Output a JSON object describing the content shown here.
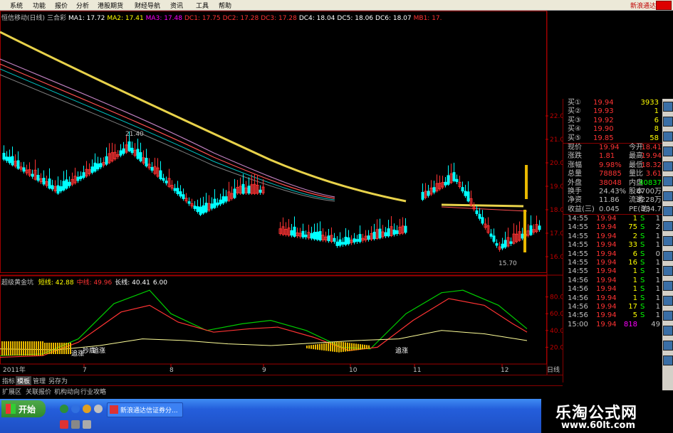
{
  "menu": {
    "items": [
      "系统",
      "功能",
      "报价",
      "分析",
      "港股期货",
      "财经导航",
      "资讯",
      "工具",
      "帮助"
    ],
    "brand": "新浪通达"
  },
  "chart_title": [
    {
      "text": "恒信移动(日线)",
      "color": "#c0c0c0"
    },
    {
      "text": "三合彩",
      "color": "#c0c0c0"
    },
    {
      "text": "MA1: 17.72",
      "color": "#ffffff"
    },
    {
      "text": "MA2: 17.41",
      "color": "#ffff00"
    },
    {
      "text": "MA3: 17.48",
      "color": "#ff00ff"
    },
    {
      "text": "DC1: 17.75",
      "color": "#ff3333"
    },
    {
      "text": "DC2: 17.28",
      "color": "#ff3333"
    },
    {
      "text": "DC3: 17.28",
      "color": "#ff3333"
    },
    {
      "text": "DC4: 18.04",
      "color": "#ffffff"
    },
    {
      "text": "DC5: 18.06",
      "color": "#ffffff"
    },
    {
      "text": "DC6: 18.07",
      "color": "#ffffff"
    },
    {
      "text": "MB1: 17.",
      "color": "#ff3333"
    }
  ],
  "price_axis": [
    "22.00",
    "21.00",
    "20.00",
    "19.00",
    "18.00",
    "17.00",
    "16.00"
  ],
  "annotations": {
    "high": "21.40",
    "low": "15.70"
  },
  "indicator": {
    "title": "超级黄金坑",
    "items": [
      {
        "text": "短线: 42.88",
        "color": "#ffff00"
      },
      {
        "text": "中线: 49.96",
        "color": "#ff3333"
      },
      {
        "text": "长线: 40.41",
        "color": "#ffffff"
      },
      {
        "text": "6.00",
        "color": "#ffffff"
      }
    ],
    "labels": [
      "抄底",
      "追涨",
      "追涨",
      "追涨"
    ],
    "axis": [
      "80.00",
      "60.00",
      "40.00",
      "20.00"
    ]
  },
  "date_axis": {
    "year": "2011年",
    "months": [
      "7",
      "8",
      "9",
      "10",
      "11",
      "12"
    ],
    "period": "日线"
  },
  "tabs": [
    "指标",
    "模板",
    "管理",
    "另存为"
  ],
  "ext_tabs": [
    "扩展区",
    "关联报价",
    "机构动向",
    "行业攻略"
  ],
  "quote": {
    "bids": [
      {
        "label": "买①",
        "price": "19.94",
        "vol": "3933"
      },
      {
        "label": "买②",
        "price": "19.93",
        "vol": "1"
      },
      {
        "label": "买③",
        "price": "19.92",
        "vol": "6"
      },
      {
        "label": "买④",
        "price": "19.90",
        "vol": "8"
      },
      {
        "label": "买⑤",
        "price": "19.85",
        "vol": "58"
      }
    ],
    "stats": [
      {
        "k1": "现价",
        "v1": "19.94",
        "k2": "今开",
        "v2": "18.41"
      },
      {
        "k1": "涨跌",
        "v1": "1.81",
        "k2": "最高",
        "v2": "19.94"
      },
      {
        "k1": "涨幅",
        "v1": "9.98%",
        "k2": "最低",
        "v2": "18.32"
      },
      {
        "k1": "总量",
        "v1": "78885",
        "k2": "量比",
        "v2": "3.61"
      },
      {
        "k1": "外盘",
        "v1": "38048",
        "k2": "内盘",
        "v2": "40837"
      },
      {
        "k1": "换手",
        "v1": "24.43%",
        "k2": "股本",
        "v2": "6700万"
      },
      {
        "k1": "净资",
        "v1": "11.86",
        "k2": "流通",
        "v2": "3228万"
      },
      {
        "k1": "收益(三)",
        "v1": "0.045",
        "k2": "PE(动)",
        "v2": "334.7"
      }
    ],
    "ticks": [
      {
        "time": "14:55",
        "price": "19.94",
        "vol": "1",
        "side": "S",
        "n": "1"
      },
      {
        "time": "14:55",
        "price": "19.94",
        "vol": "75",
        "side": "S",
        "n": "2"
      },
      {
        "time": "14:55",
        "price": "19.94",
        "vol": "2",
        "side": "S",
        "n": "1"
      },
      {
        "time": "14:55",
        "price": "19.94",
        "vol": "33",
        "side": "S",
        "n": "1"
      },
      {
        "time": "14:55",
        "price": "19.94",
        "vol": "6",
        "side": "S",
        "n": "0"
      },
      {
        "time": "14:55",
        "price": "19.94",
        "vol": "16",
        "side": "S",
        "n": "1"
      },
      {
        "time": "14:55",
        "price": "19.94",
        "vol": "1",
        "side": "S",
        "n": "1"
      },
      {
        "time": "14:56",
        "price": "19.94",
        "vol": "1",
        "side": "S",
        "n": "1"
      },
      {
        "time": "14:56",
        "price": "19.94",
        "vol": "1",
        "side": "S",
        "n": "1"
      },
      {
        "time": "14:56",
        "price": "19.94",
        "vol": "1",
        "side": "S",
        "n": "1"
      },
      {
        "time": "14:56",
        "price": "19.94",
        "vol": "17",
        "side": "S",
        "n": "1"
      },
      {
        "time": "14:56",
        "price": "19.94",
        "vol": "5",
        "side": "S",
        "n": "1"
      },
      {
        "time": "15:00",
        "price": "19.94",
        "vol": "818",
        "side": "",
        "n": "49"
      }
    ]
  },
  "taskbar": {
    "start": "开始",
    "item": "新浪通达信证券分..."
  },
  "watermark": {
    "line1": "乐淘公式网",
    "line2": "www.60lt.com"
  },
  "colors": {
    "up": "#ff3333",
    "down": "#00ffff",
    "axis": "#c00000",
    "ma_yellow": "#e8d24a",
    "accent_blue": "#245edb"
  }
}
